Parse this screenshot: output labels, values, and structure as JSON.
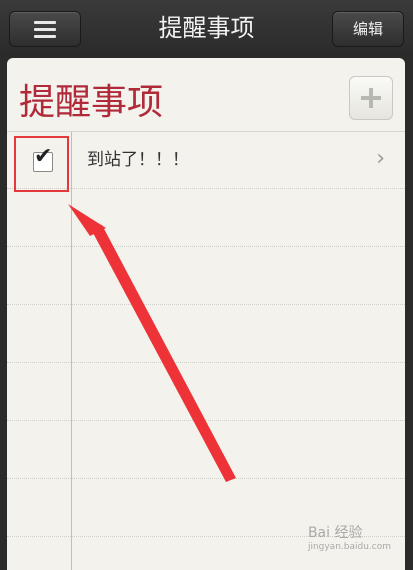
{
  "header": {
    "title": "提醒事项",
    "edit_label": "编辑"
  },
  "list": {
    "title": "提醒事项",
    "items": [
      {
        "text": "到站了！！！",
        "checked": true
      }
    ]
  },
  "icons": {
    "menu": "hamburger-icon",
    "add": "plus-icon",
    "check": "checkmark-icon",
    "chevron": "chevron-right-icon"
  },
  "glyphs": {
    "check": "✔",
    "chevron": "›"
  },
  "watermark": {
    "text": "Bai 经验",
    "sub": "jingyan.baidu.com"
  },
  "colors": {
    "title_red": "#b02a3a",
    "annotation_red": "#e6373b",
    "paper": "#f3f2ec",
    "bar": "#2b2b2b"
  }
}
